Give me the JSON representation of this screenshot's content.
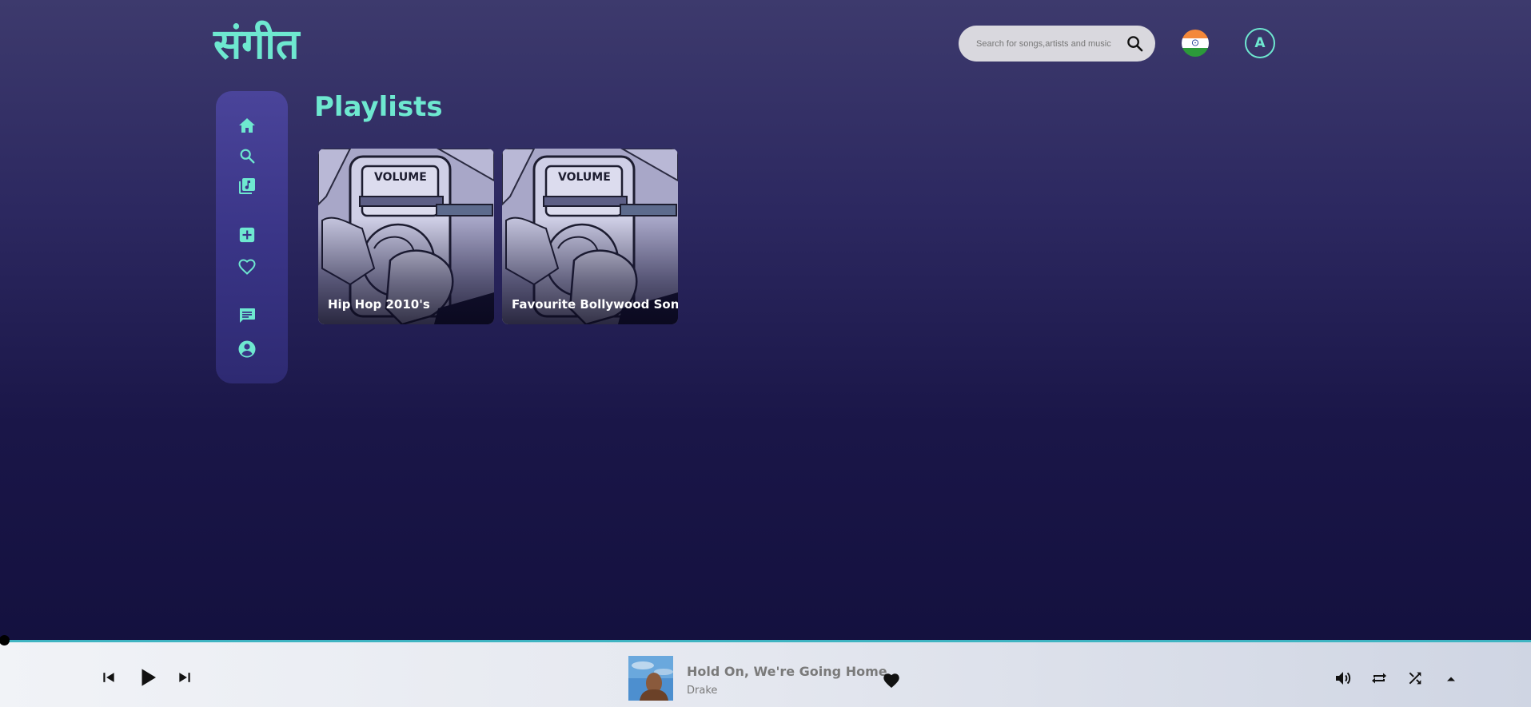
{
  "app": {
    "logo_text": "संगीत"
  },
  "header": {
    "search_placeholder": "Search for songs,artists and music",
    "avatar_initial": "A"
  },
  "sidebar": {
    "items": [
      {
        "icon": "home-icon"
      },
      {
        "icon": "search-icon"
      },
      {
        "icon": "library-music-icon"
      },
      {
        "icon": "add-box-icon"
      },
      {
        "icon": "heart-outline-icon"
      },
      {
        "icon": "chat-icon"
      },
      {
        "icon": "account-circle-icon"
      }
    ]
  },
  "main": {
    "title": "Playlists",
    "playlists": [
      {
        "name": "Hip Hop 2010's"
      },
      {
        "name": "Favourite Bollywood Songs"
      }
    ]
  },
  "player": {
    "track_title": "Hold On, We're Going Home",
    "artist": "Drake",
    "progress": 0.0,
    "liked": true
  },
  "colors": {
    "accent": "#6ee8d0",
    "background_top": "#3d3a6d",
    "background_bottom": "#120f3c",
    "sidebar": "#3a3587",
    "player_bar": "#e4e7ef",
    "progress_track": "#3fb4c2"
  }
}
